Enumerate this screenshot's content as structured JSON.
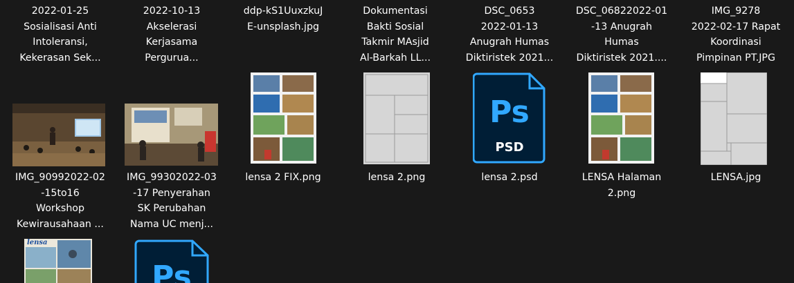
{
  "files": [
    {
      "name_lines": [
        "2022-01-25",
        "Sosialisasi Anti",
        "Intoleransi,",
        "Kekerasan Sek..."
      ]
    },
    {
      "name_lines": [
        "2022-10-13",
        "Akselerasi",
        "Kerjasama",
        "Pergurua..."
      ]
    },
    {
      "name_lines": [
        "ddp-kS1UuxzkuJ",
        "E-unsplash.jpg"
      ]
    },
    {
      "name_lines": [
        "Dokumentasi",
        "Bakti Sosial",
        "Takmir MAsjid",
        "Al-Barkah LL..."
      ]
    },
    {
      "name_lines": [
        "DSC_0653",
        "2022-01-13",
        "Anugrah Humas",
        "Diktiristek 2021..."
      ]
    },
    {
      "name_lines": [
        "DSC_06822022-01",
        "-13 Anugrah",
        "Humas",
        "Diktiristek 2021...."
      ]
    },
    {
      "name_lines": [
        "IMG_9278",
        "2022-02-17 Rapat",
        "Koordinasi",
        "Pimpinan PT.JPG"
      ]
    },
    {
      "name_lines": [
        "IMG_90992022-02",
        "-15to16",
        "Workshop",
        "Kewirausahaan ..."
      ]
    },
    {
      "name_lines": [
        "IMG_99302022-03",
        "-17 Penyerahan",
        "SK Perubahan",
        "Nama UC menj..."
      ]
    },
    {
      "name_lines": [
        "lensa 2 FIX.png"
      ]
    },
    {
      "name_lines": [
        "lensa 2.png"
      ]
    },
    {
      "name_lines": [
        "lensa 2.psd"
      ]
    },
    {
      "name_lines": [
        "LENSA Halaman",
        "2.png"
      ]
    },
    {
      "name_lines": [
        "LENSA.jpg"
      ]
    }
  ],
  "psd_icon": {
    "ps_text": "Ps",
    "ext_text": "PSD",
    "accent": "#31a8ff",
    "bg": "#001e36"
  },
  "thumb_overlay": {
    "lensa_text": "lensa"
  },
  "colors": {
    "background": "#191919",
    "text": "#ffffff"
  }
}
